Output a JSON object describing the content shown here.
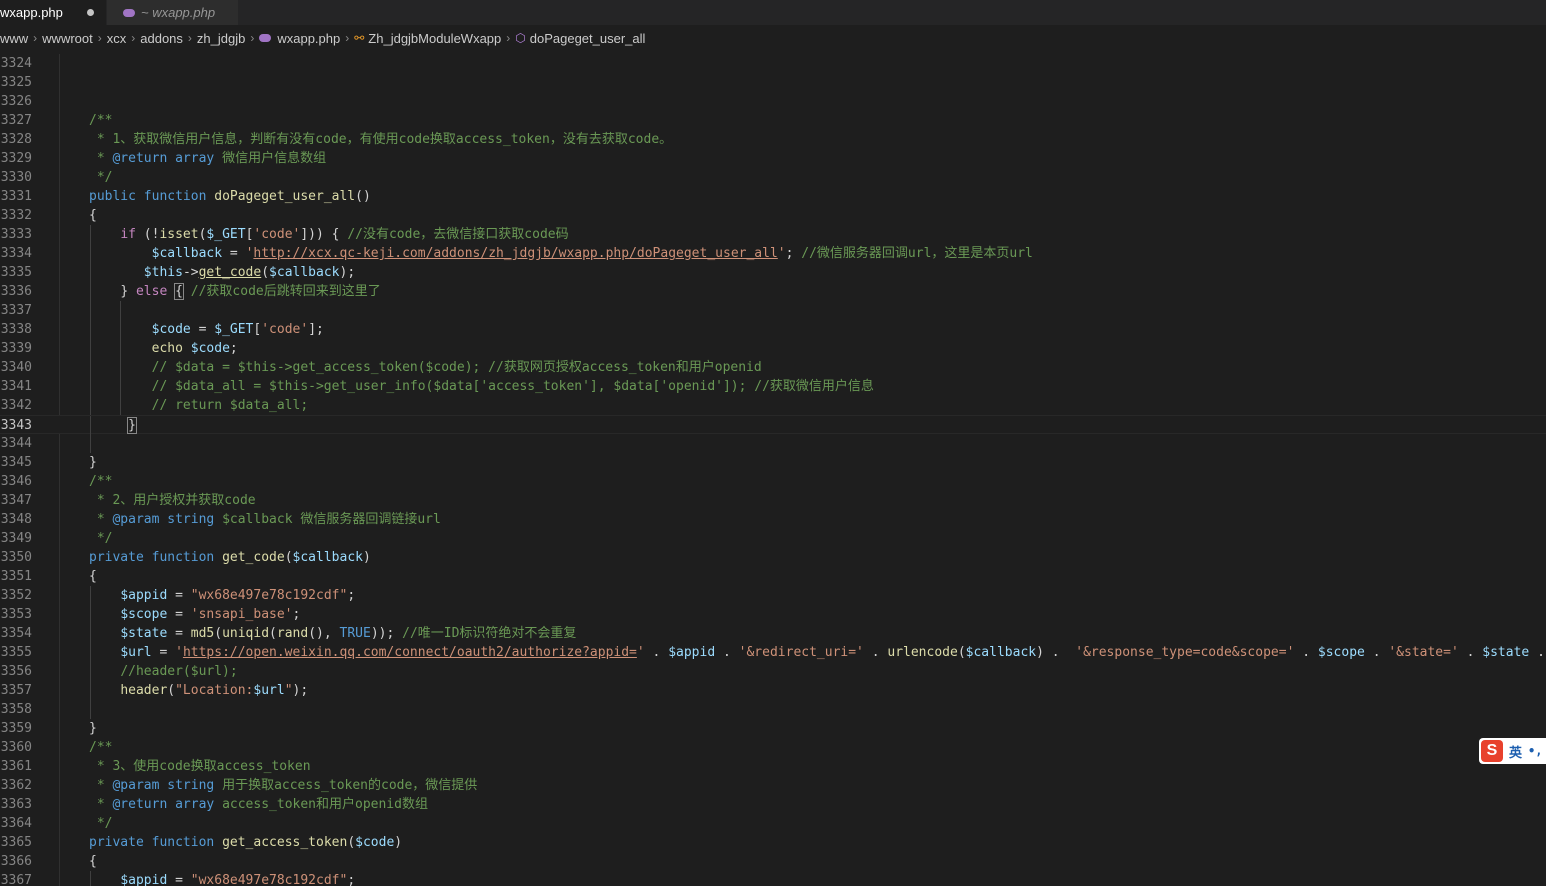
{
  "tabs": [
    {
      "name": "wxapp.php",
      "modified": true
    },
    {
      "name": "~ wxapp.php"
    }
  ],
  "breadcrumb": [
    "www",
    "wwwroot",
    "xcx",
    "addons",
    "zh_jdgjb",
    "wxapp.php",
    "Zh_jdgjbModuleWxapp",
    "doPageget_user_all"
  ],
  "editor": {
    "current_line": "3343",
    "line_numbers": [
      "3324",
      "3325",
      "3326",
      "3327",
      "3328",
      "3329",
      "3330",
      "3331",
      "3332",
      "3333",
      "3334",
      "3335",
      "3336",
      "3337",
      "3338",
      "3339",
      "3340",
      "3341",
      "3342",
      "3343",
      "3344",
      "3345",
      "3346",
      "3347",
      "3348",
      "3349",
      "3350",
      "3351",
      "3352",
      "3353",
      "3354",
      "3355",
      "3356",
      "3357",
      "3358",
      "3359",
      "3360",
      "3361",
      "3362",
      "3363",
      "3364",
      "3365",
      "3366",
      "3367"
    ]
  },
  "ime": {
    "label": "英",
    "punct": "•,"
  },
  "colors": {
    "background": "#1e1e1e",
    "comment": "#6a9955",
    "keyword": "#569cd6",
    "function": "#dcdcaa",
    "variable": "#9cdcfe",
    "string": "#ce9178"
  }
}
